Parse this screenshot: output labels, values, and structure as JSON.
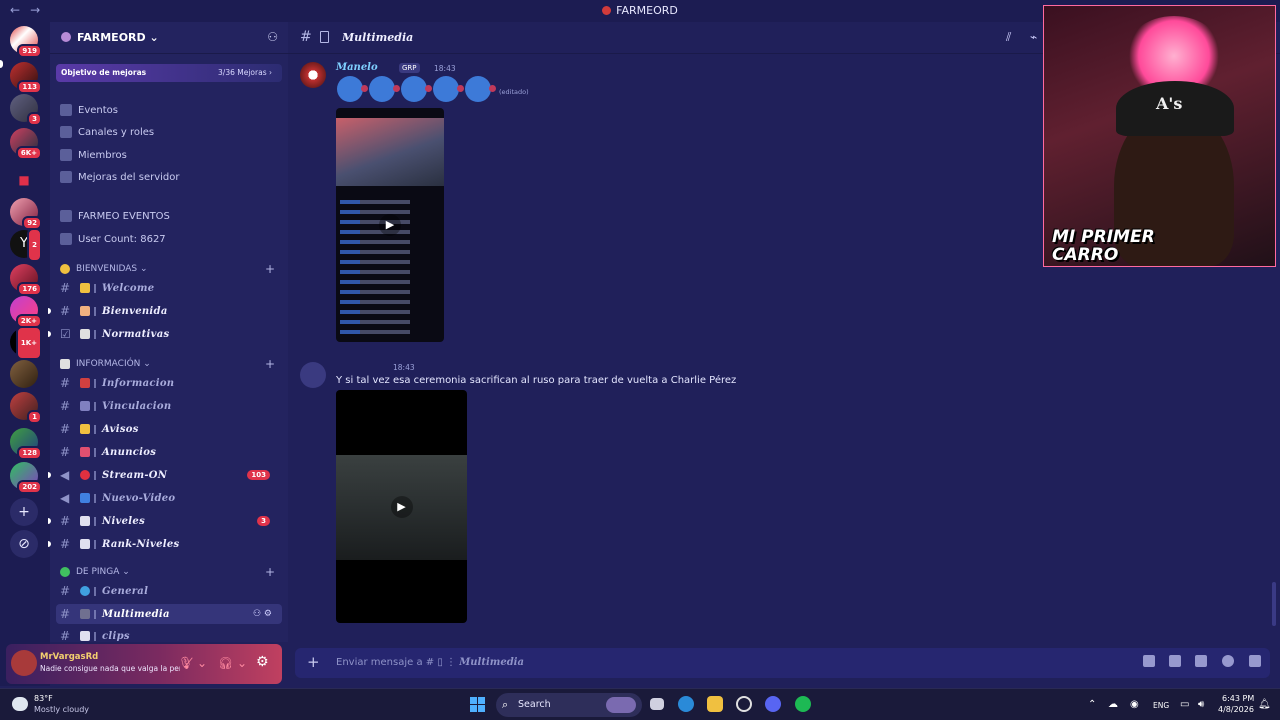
{
  "window": {
    "title": "FARMEORD",
    "back": "←",
    "forward": "→"
  },
  "servers": [
    {
      "badge": "919"
    },
    {
      "badge": "113"
    },
    {
      "badge": "3"
    },
    {
      "badge": "6K+"
    },
    {
      "badge": ""
    },
    {
      "badge": "92"
    },
    {
      "badge": "2"
    },
    {
      "badge": "176"
    },
    {
      "badge": "2K+"
    },
    {
      "badge": "1K+"
    },
    {
      "badge": ""
    },
    {
      "badge": "1"
    },
    {
      "badge": "128"
    },
    {
      "badge": "202"
    }
  ],
  "sidebar": {
    "server_name": "FARMEORD ⌄",
    "boost_label": "Objetivo de mejoras",
    "boost_count": "3/36 Mejoras ›",
    "menu": [
      "Eventos",
      "Canales y roles",
      "Miembros",
      "Mejoras del servidor"
    ],
    "stats": [
      "FARMEO EVENTOS",
      "User Count: 8627"
    ],
    "categories": [
      {
        "name": "BIENVENIDAS ⌄",
        "channels": [
          {
            "name": "Welcome",
            "badge": ""
          },
          {
            "name": "Bienvenida",
            "badge": ""
          },
          {
            "name": "Normativas",
            "badge": ""
          }
        ]
      },
      {
        "name": "INFORMACIÓN ⌄",
        "channels": [
          {
            "name": "Informacion",
            "badge": ""
          },
          {
            "name": "Vinculacion",
            "badge": ""
          },
          {
            "name": "Avisos",
            "badge": ""
          },
          {
            "name": "Anuncios",
            "badge": ""
          },
          {
            "name": "Stream-ON",
            "badge": "103"
          },
          {
            "name": "Nuevo-Video",
            "badge": ""
          },
          {
            "name": "Niveles",
            "badge": "3"
          },
          {
            "name": "Rank-Niveles",
            "badge": ""
          }
        ]
      },
      {
        "name": "DE PINGA ⌄",
        "channels": [
          {
            "name": "General",
            "badge": ""
          },
          {
            "name": "Multimedia",
            "badge": ""
          },
          {
            "name": "clips",
            "badge": ""
          }
        ]
      }
    ]
  },
  "user": {
    "name": "MrVargasRd",
    "status": "Nadie consigue nada que valga la pen",
    "settings_icon": "gear-icon"
  },
  "channel": {
    "title": "Multimedia"
  },
  "messages": [
    {
      "author": "Manelo",
      "tag": "GRP",
      "time": "18:43",
      "edited": "(editado)"
    },
    {
      "author": "",
      "time": "18:43",
      "text": "Y si tal vez esa ceremonia sacrifican al ruso para traer de vuelta a Charlie Pérez"
    }
  ],
  "composer": {
    "placeholder": "Enviar mensaje a #",
    "channel": "Multimedia"
  },
  "webcam": {
    "cap_text": "A's",
    "overlay_line1": "MI PRIMER",
    "overlay_line2": "CARRO"
  },
  "taskbar": {
    "weather_temp": "83°F",
    "weather_desc": "Mostly cloudy",
    "search": "Search",
    "lang": "ENG",
    "time": "6:43 PM",
    "date": "4/8/2026"
  }
}
